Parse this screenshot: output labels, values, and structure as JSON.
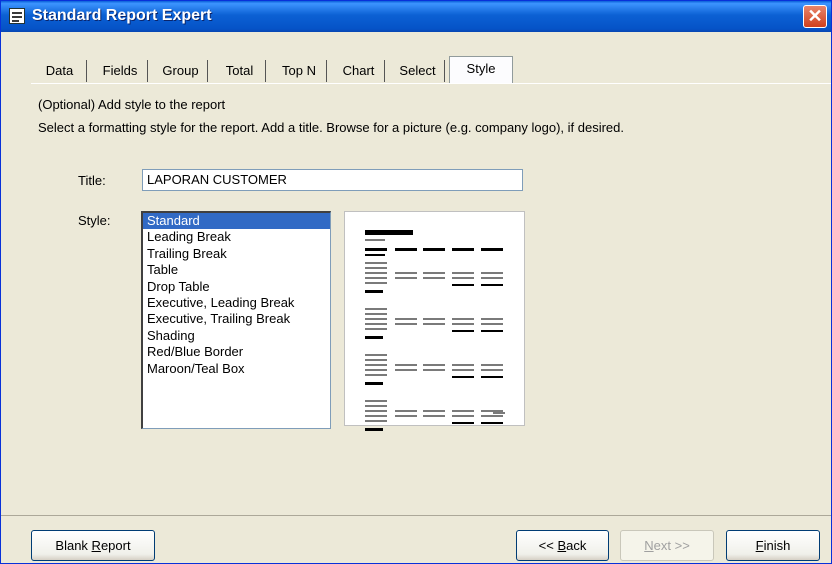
{
  "window": {
    "title": "Standard Report Expert",
    "close_label": "✕"
  },
  "tabs": [
    {
      "label": "Data"
    },
    {
      "label": "Fields"
    },
    {
      "label": "Group"
    },
    {
      "label": "Total"
    },
    {
      "label": "Top N"
    },
    {
      "label": "Chart"
    },
    {
      "label": "Select"
    },
    {
      "label": "Style",
      "active": true
    }
  ],
  "style_tab": {
    "heading": "(Optional) Add style to the report",
    "instructions": "Select a formatting style for the report.  Add a title.  Browse for a picture (e.g. company logo), if desired.",
    "title_label": "Title:",
    "title_value": "LAPORAN CUSTOMER",
    "style_label": "Style:",
    "styles": [
      "Standard",
      "Leading Break",
      "Trailing Break",
      "Table",
      "Drop Table",
      "Executive, Leading Break",
      "Executive, Trailing Break",
      "Shading",
      "Red/Blue Border",
      "Maroon/Teal Box"
    ],
    "selected_style": "Standard"
  },
  "buttons": {
    "blank_report": "Blank Report",
    "back": "<< Back",
    "next": "Next >>",
    "finish": "Finish"
  },
  "colors": {
    "titlebar": "#0553c7",
    "selection": "#316ac5",
    "dialog_bg": "#ece9d8"
  }
}
